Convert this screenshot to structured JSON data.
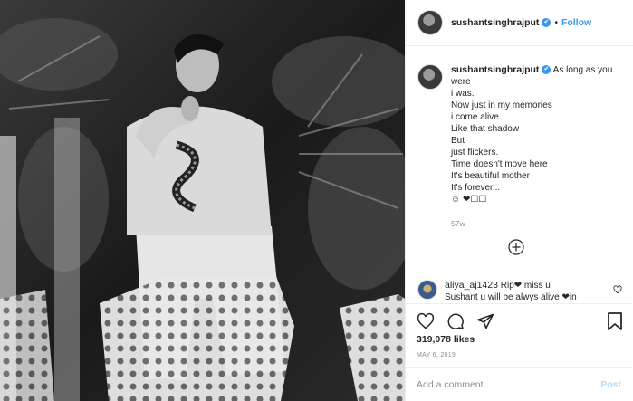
{
  "header": {
    "username": "sushantsinghrajput",
    "separator": "•",
    "follow_label": "Follow"
  },
  "caption": {
    "username": "sushantsinghrajput",
    "lines": [
      "As long as you",
      "were",
      "i was.",
      "Now just in my memories",
      "i come alive.",
      "Like that shadow",
      "But",
      "just flickers.",
      "Time doesn't move here",
      "It's beautiful mother",
      "It's forever...",
      "☺ ❤☐☐"
    ],
    "time_ago": "57w"
  },
  "comment": {
    "username": "aliya_aj1423",
    "line1": "Rip❤ miss u",
    "line2": "Sushant u will be alwys alive ❤in"
  },
  "actions": {
    "likes": "319,078 likes",
    "date": "MAY 6, 2019"
  },
  "add_comment": {
    "placeholder": "Add a comment...",
    "post_label": "Post"
  },
  "icons": {
    "verified": "verified-badge-icon",
    "more": "plus-circle-icon",
    "like": "heart-icon",
    "comment": "comment-bubble-icon",
    "share": "paper-plane-icon",
    "save": "bookmark-icon",
    "comment_like": "small-heart-icon"
  }
}
